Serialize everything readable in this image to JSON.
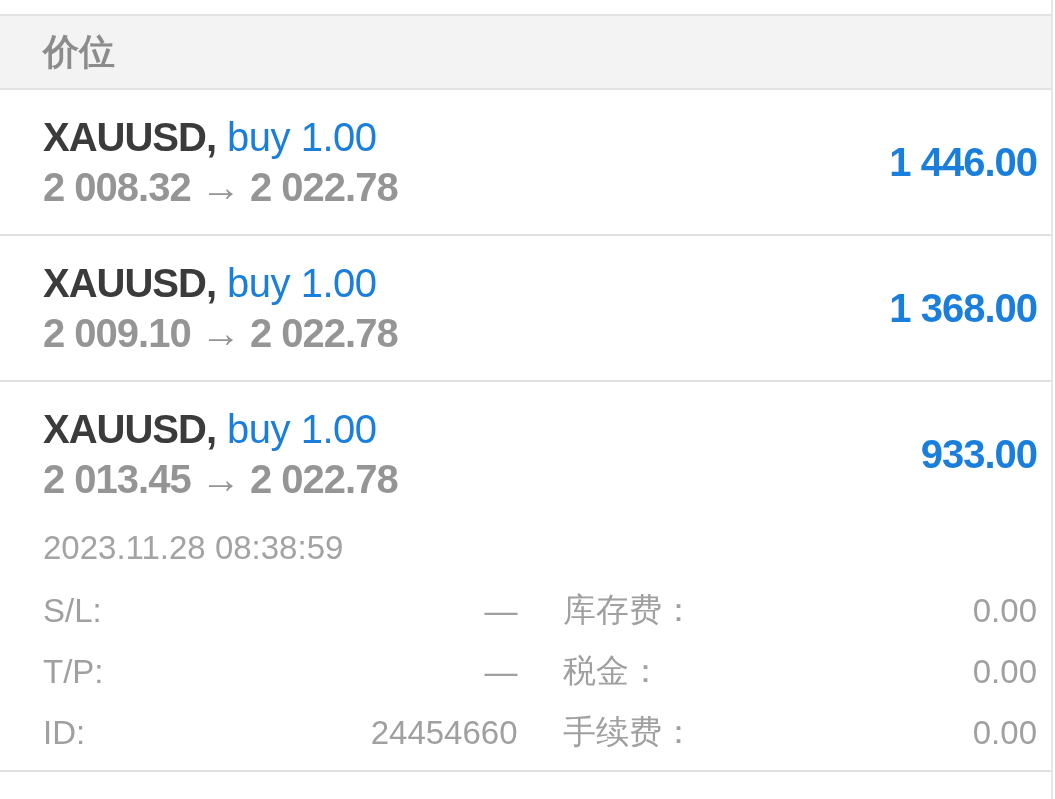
{
  "header": {
    "title": "价位"
  },
  "positions": [
    {
      "symbol": "XAUUSD,",
      "side": "buy 1.00",
      "prices": "2 008.32 → 2 022.78",
      "profit": "1 446.00"
    },
    {
      "symbol": "XAUUSD,",
      "side": "buy 1.00",
      "prices": "2 009.10 → 2 022.78",
      "profit": "1 368.00"
    },
    {
      "symbol": "XAUUSD,",
      "side": "buy 1.00",
      "prices": "2 013.45 → 2 022.78",
      "profit": "933.00",
      "details": {
        "time": "2023.11.28 08:38:59",
        "fields": [
          {
            "label": "S/L:",
            "value": "—"
          },
          {
            "label": "库存费：",
            "value": "0.00"
          },
          {
            "label": "T/P:",
            "value": "—"
          },
          {
            "label": "税金：",
            "value": "0.00"
          },
          {
            "label": "ID:",
            "value": "24454660"
          },
          {
            "label": "手续费：",
            "value": "0.00"
          }
        ]
      }
    }
  ]
}
